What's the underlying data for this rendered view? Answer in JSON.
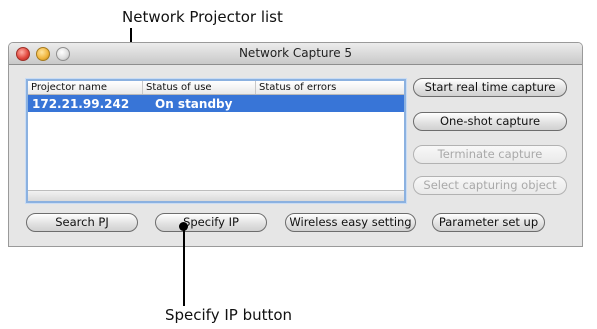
{
  "callouts": {
    "top": "Network Projector list",
    "bottom": "Specify IP button"
  },
  "window": {
    "title": "Network Capture 5"
  },
  "list": {
    "columns": [
      "Projector name",
      "Status of use",
      "Status of errors"
    ],
    "rows": [
      {
        "name": "172.21.99.242",
        "status": "On standby",
        "errors": "",
        "selected": true
      }
    ]
  },
  "buttons": {
    "start": "Start real time capture",
    "oneshot": "One-shot capture",
    "terminate": "Terminate capture",
    "select": "Select capturing object",
    "search": "Search PJ",
    "specify": "Specify IP",
    "wireless": "Wireless easy setting",
    "param": "Parameter set up"
  },
  "colors": {
    "selection": "#3875d7",
    "focus_ring": "#8bb1e0"
  }
}
